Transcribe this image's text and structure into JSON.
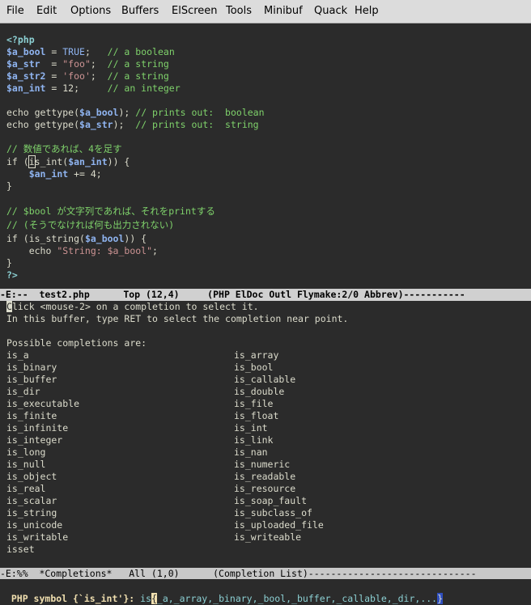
{
  "menu": [
    "File",
    "Edit",
    "Options",
    "Buffers",
    "ElScreen",
    "Tools",
    "Minibuf",
    "Quack",
    "Help"
  ],
  "code": {
    "php_open": "<?php",
    "bool_var": "$a_bool",
    "bool_eq": " = ",
    "bool_val": "TRUE",
    "bool_rest": ";   ",
    "bool_cmt": "// a boolean",
    "str_var": "$a_str",
    "str_eq": "  = ",
    "str_val": "\"foo\"",
    "str_rest": ";  ",
    "str_cmt": "// a string",
    "str2_var": "$a_str2",
    "str2_eq": " = ",
    "str2_val": "'foo'",
    "str2_rest": ";  ",
    "str2_cmt": "// a string",
    "int_var": "$an_int",
    "int_eq": " = 12;     ",
    "int_cmt": "// an integer",
    "echo1_a": "echo gettype(",
    "echo1_var": "$a_bool",
    "echo1_b": "); ",
    "echo1_cmt": "// prints out:  boolean",
    "echo2_a": "echo gettype(",
    "echo2_var": "$a_str",
    "echo2_b": ");  ",
    "echo2_cmt": "// prints out:  string",
    "jp_cmt1": "// 数値であれば、4を足す",
    "if1_a": "if (",
    "if1_cur": "i",
    "if1_b": "s_int(",
    "if1_var": "$an_int",
    "if1_c": ")) {",
    "inc_indent": "    ",
    "inc_var": "$an_int",
    "inc_rest": " += 4;",
    "close1": "}",
    "jp_cmt2": "// $bool が文字列であれば、それをprintする",
    "jp_cmt3": "// (そうでなければ何も出力されない)",
    "if2_a": "if (is_string(",
    "if2_var": "$a_bool",
    "if2_b": ")) {",
    "echo3_a": "    echo ",
    "echo3_str": "\"String: $a_bool\"",
    "echo3_b": ";",
    "close2": "}",
    "php_close": "?>"
  },
  "modeline1": "-E:--  test2.php      Top (12,4)     (PHP ElDoc Outl Flymake:2/0 Abbrev)-----------",
  "completions": {
    "help1_cur": "C",
    "help1": "lick <mouse-2> on a completion to select it.",
    "help2": "In this buffer, type RET to select the completion near point.",
    "header": "Possible completions are:",
    "left": [
      "is_a",
      "is_binary",
      "is_buffer",
      "is_dir",
      "is_executable",
      "is_finite",
      "is_infinite",
      "is_integer",
      "is_long",
      "is_null",
      "is_object",
      "is_real",
      "is_scalar",
      "is_string",
      "is_unicode",
      "is_writable",
      "isset"
    ],
    "right": [
      "is_array",
      "is_bool",
      "is_callable",
      "is_double",
      "is_file",
      "is_float",
      "is_int",
      "is_link",
      "is_nan",
      "is_numeric",
      "is_readable",
      "is_resource",
      "is_soap_fault",
      "is_subclass_of",
      "is_uploaded_file",
      "is_writeable"
    ]
  },
  "modeline2": "-E:%%  *Completions*   All (1,0)      (Completion List)------------------------------",
  "minibuffer": {
    "prompt": "PHP symbol {`is_int'}: ",
    "typed": "is",
    "cursor": "{",
    "rest": "_a,_array,_binary,_bool,_buffer,_callable,_dir,...",
    "close": "}"
  }
}
